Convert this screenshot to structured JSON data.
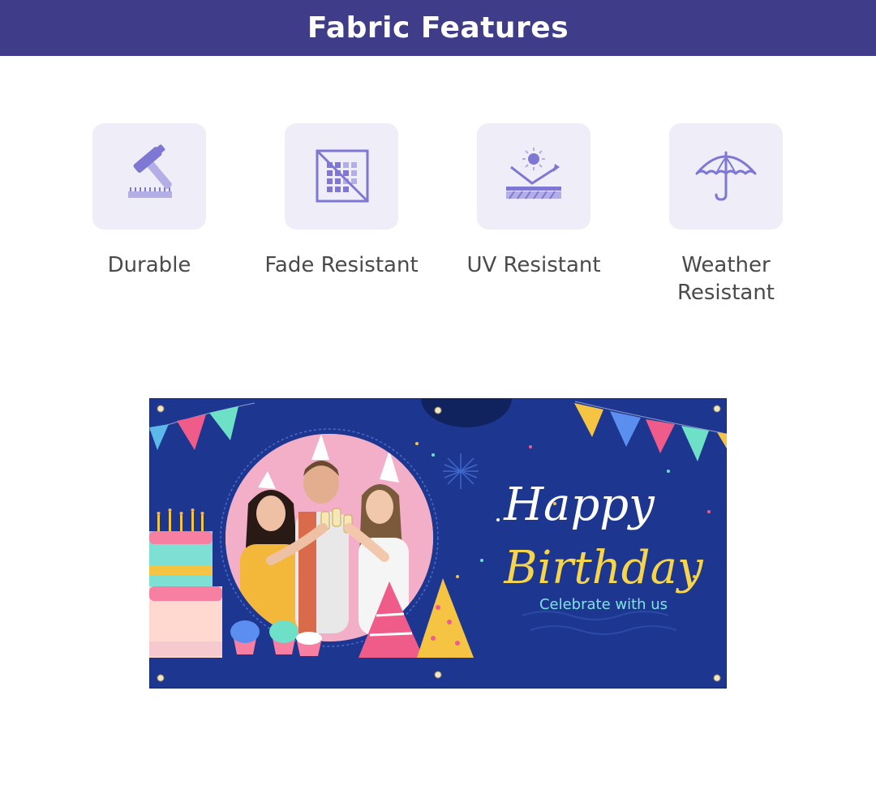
{
  "header": {
    "title": "Fabric Features"
  },
  "features": [
    {
      "label": "Durable",
      "icon": "hammer-icon"
    },
    {
      "label": "Fade Resistant",
      "icon": "fade-grid-icon"
    },
    {
      "label": "UV Resistant",
      "icon": "sun-reflect-icon"
    },
    {
      "label": "Weather Resistant",
      "icon": "umbrella-icon"
    }
  ],
  "banner": {
    "line1": "Happy",
    "line2": "Birthday",
    "tagline": "Celebrate with us"
  },
  "colors": {
    "header_bg": "#3f3c89",
    "tile_bg": "#efeef8",
    "icon": "#7f77d4",
    "banner_bg": "#1d3790",
    "banner_yellow": "#f6d44b",
    "banner_teal": "#7fe3e0"
  }
}
